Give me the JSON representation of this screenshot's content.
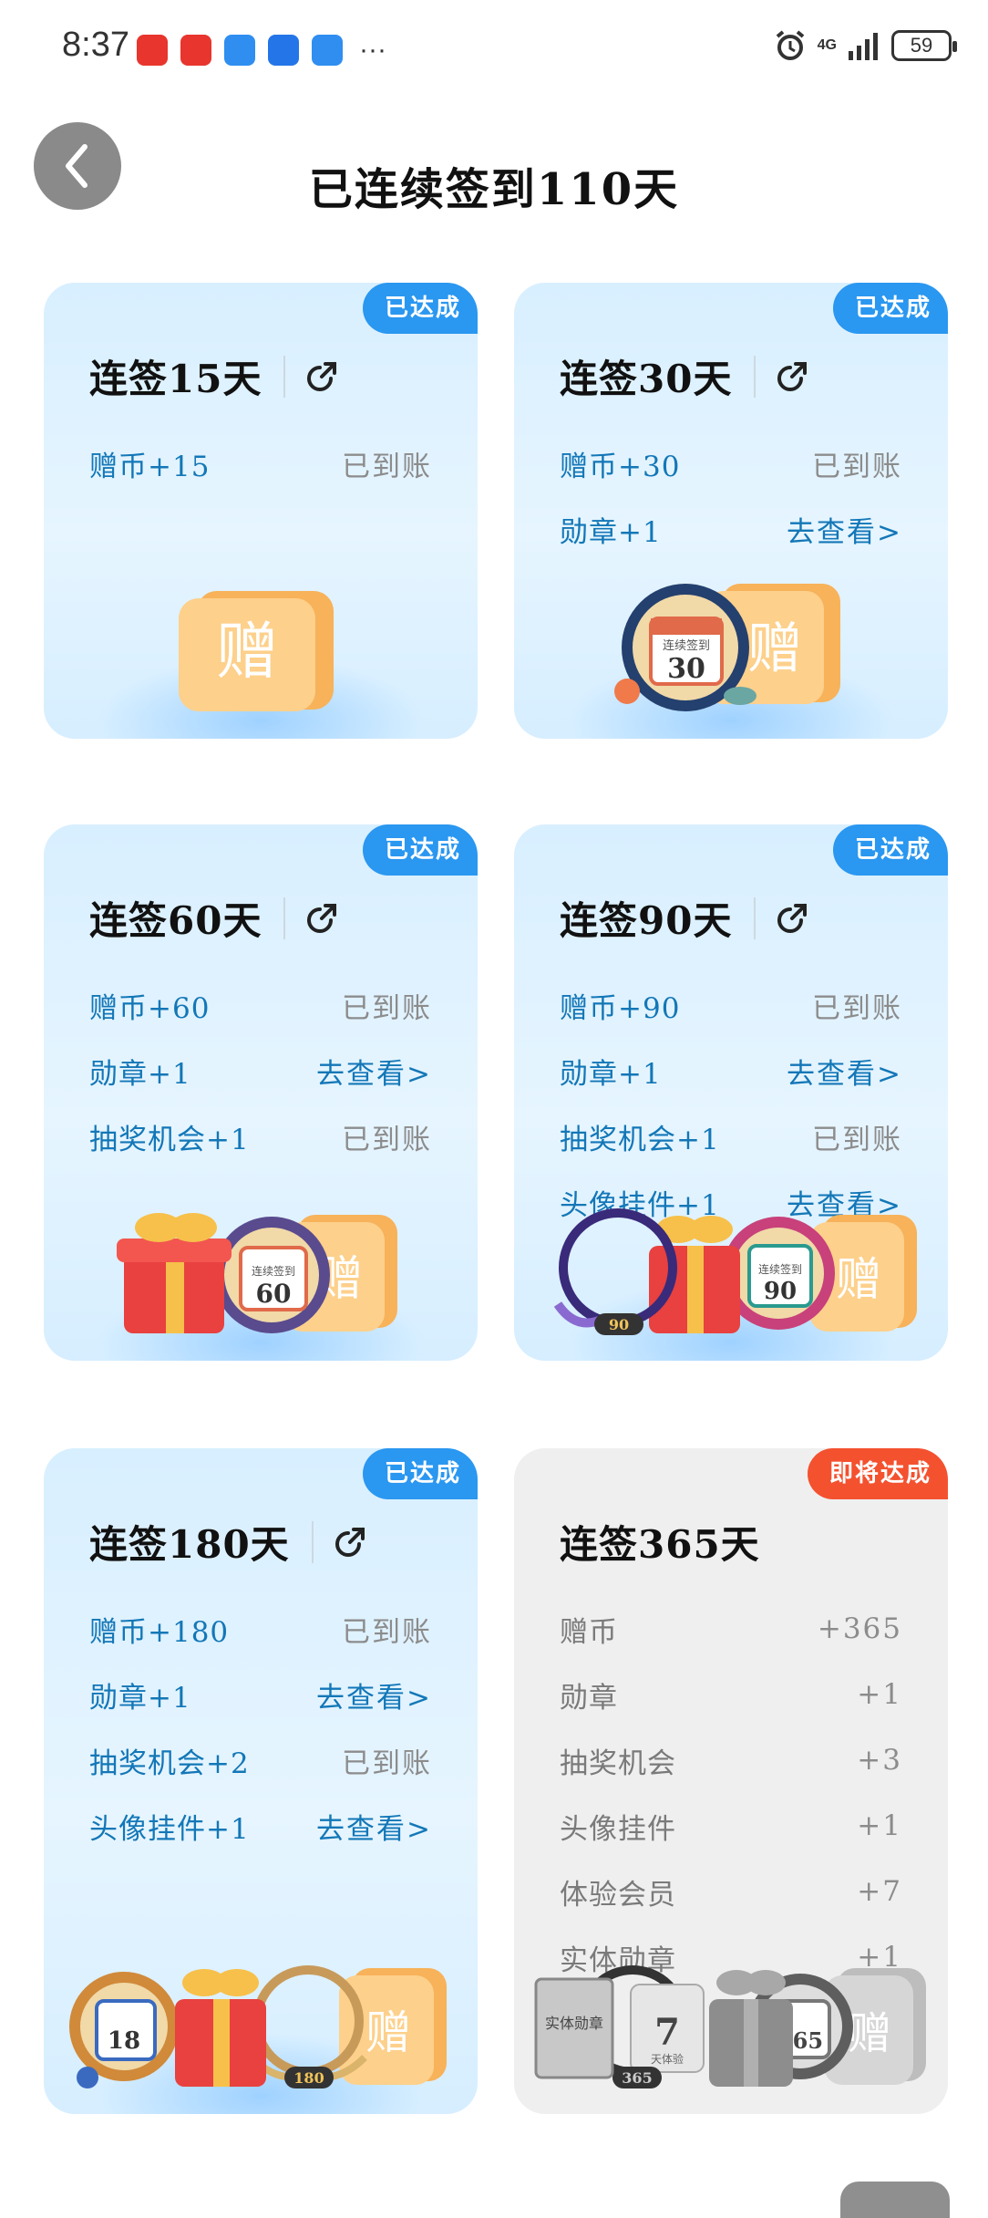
{
  "status_bar": {
    "time": "8:37",
    "network": "4G",
    "battery": "59",
    "more": "···",
    "app_icons": [
      "#e8352d",
      "#e8352d",
      "#2f8ef0",
      "#2476e8",
      "#2f8ef0"
    ]
  },
  "header": {
    "title": "已连续签到110天"
  },
  "colors": {
    "accent_blue": "#1377b7",
    "badge_blue": "#2a97f0",
    "badge_orange": "#f4512f"
  },
  "cards": [
    {
      "title": "连签15天",
      "badge": "已达成",
      "rows": [
        {
          "key": "赠币+15",
          "value": "已到账"
        }
      ],
      "art": [
        "赠"
      ]
    },
    {
      "title": "连签30天",
      "badge": "已达成",
      "rows": [
        {
          "key": "赠币+30",
          "value": "已到账"
        },
        {
          "key": "勋章+1",
          "value": "去查看>"
        }
      ],
      "art": [
        "连续签到",
        "30",
        "赠"
      ]
    },
    {
      "title": "连签60天",
      "badge": "已达成",
      "rows": [
        {
          "key": "赠币+60",
          "value": "已到账"
        },
        {
          "key": "勋章+1",
          "value": "去查看>"
        },
        {
          "key": "抽奖机会+1",
          "value": "已到账"
        }
      ],
      "art": [
        "连续签到",
        "60",
        "赠"
      ]
    },
    {
      "title": "连签90天",
      "badge": "已达成",
      "rows": [
        {
          "key": "赠币+90",
          "value": "已到账"
        },
        {
          "key": "勋章+1",
          "value": "去查看>"
        },
        {
          "key": "抽奖机会+1",
          "value": "已到账"
        },
        {
          "key": "头像挂件+1",
          "value": "去查看>"
        }
      ],
      "art": [
        "90",
        "连续签到",
        "90",
        "赠"
      ]
    },
    {
      "title": "连签180天",
      "badge": "已达成",
      "rows": [
        {
          "key": "赠币+180",
          "value": "已到账"
        },
        {
          "key": "勋章+1",
          "value": "去查看>"
        },
        {
          "key": "抽奖机会+2",
          "value": "已到账"
        },
        {
          "key": "头像挂件+1",
          "value": "去查看>"
        }
      ],
      "art": [
        "18",
        "180",
        "赠"
      ]
    },
    {
      "title": "连签365天",
      "badge": "即将达成",
      "rows": [
        {
          "key": "赠币",
          "value": "+365"
        },
        {
          "key": "勋章",
          "value": "+1"
        },
        {
          "key": "抽奖机会",
          "value": "+3"
        },
        {
          "key": "头像挂件",
          "value": "+1"
        },
        {
          "key": "体验会员",
          "value": "+7"
        },
        {
          "key": "实体勋章",
          "value": "+1"
        }
      ],
      "art": [
        "实体勋章",
        "7",
        "天体验",
        "365",
        "365",
        "赠"
      ]
    }
  ]
}
